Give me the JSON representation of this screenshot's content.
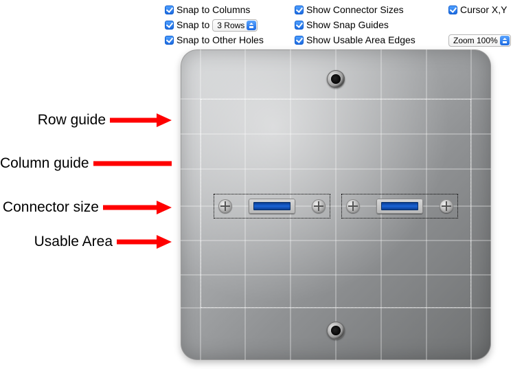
{
  "toolbar": {
    "col1": {
      "snap_columns": "Snap to Columns",
      "snap_to": "Snap to",
      "rows_select": "3 Rows",
      "snap_other_holes": "Snap to Other Holes"
    },
    "col2": {
      "show_conn_sizes": "Show Connector Sizes",
      "show_snap_guides": "Show Snap Guides",
      "show_usable_edges": "Show Usable Area Edges"
    },
    "col3": {
      "cursor_xy": "Cursor X,Y",
      "zoom_select": "Zoom 100%"
    }
  },
  "annotations": {
    "row_guide": "Row guide",
    "column_guide": "Column guide",
    "connector_size": "Connector size",
    "usable_area": "Usable Area"
  }
}
